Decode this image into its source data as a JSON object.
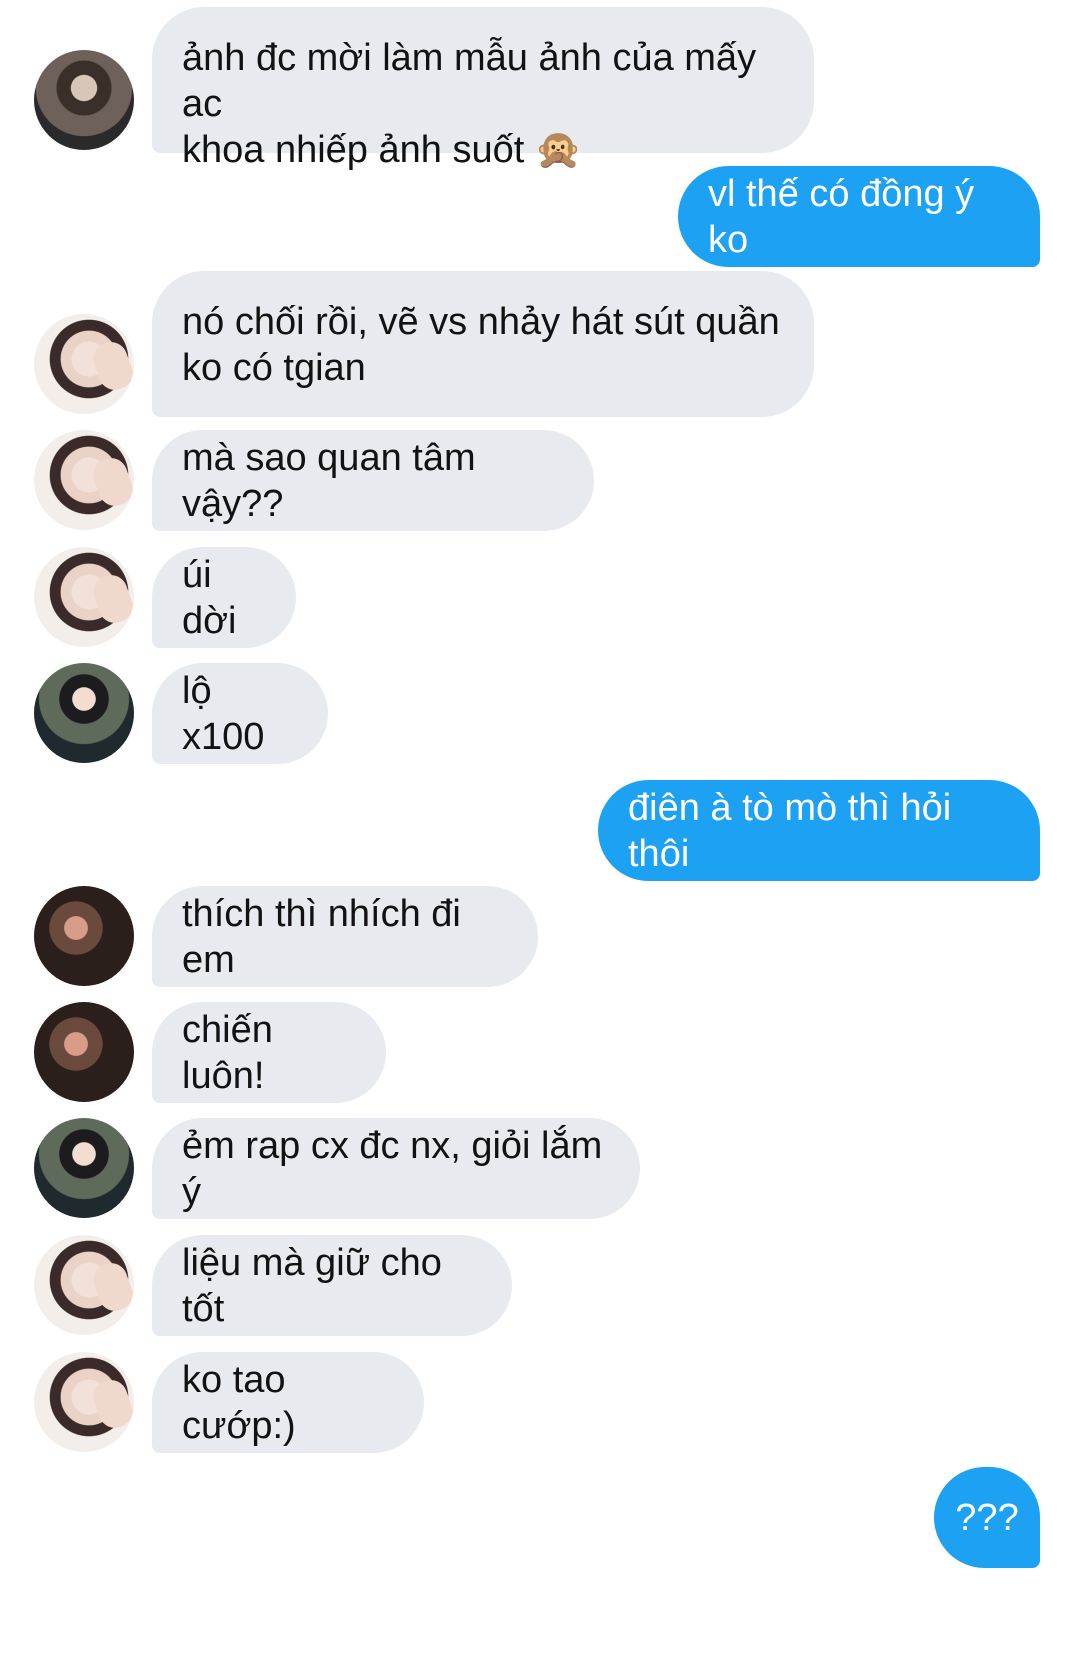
{
  "messages": [
    {
      "side": "in",
      "avatar": "avatar-a",
      "text": "ảnh đc mời làm mẫu ảnh của mấy ac\nkhoa nhiếp ảnh suốt 🙊"
    },
    {
      "side": "out",
      "text": "vl thế có đồng ý ko"
    },
    {
      "side": "in",
      "avatar": "avatar-b",
      "text": "nó chối rồi, vẽ vs nhảy hát sút quần\nko có tgian"
    },
    {
      "side": "in",
      "avatar": "avatar-b",
      "text": "mà sao quan tâm vậy??"
    },
    {
      "side": "in",
      "avatar": "avatar-b",
      "text": "úi dời"
    },
    {
      "side": "in",
      "avatar": "avatar-c",
      "text": "lộ x100"
    },
    {
      "side": "out",
      "text": "điên à tò mò thì hỏi thôi"
    },
    {
      "side": "in",
      "avatar": "avatar-d",
      "text": "thích thì nhích đi em"
    },
    {
      "side": "in",
      "avatar": "avatar-d",
      "text": "chiến luôn!"
    },
    {
      "side": "in",
      "avatar": "avatar-c",
      "text": "ẻm rap cx đc nx, giỏi lắm ý"
    },
    {
      "side": "in",
      "avatar": "avatar-b",
      "text": "liệu mà giữ cho tốt"
    },
    {
      "side": "in",
      "avatar": "avatar-b",
      "text": "ko tao cướp:)"
    },
    {
      "side": "out",
      "text": "???"
    }
  ],
  "colors": {
    "incoming_bg": "#e7ebef",
    "outgoing_bg": "#1da1f2",
    "incoming_text": "#121212",
    "outgoing_text": "#ffffff"
  }
}
